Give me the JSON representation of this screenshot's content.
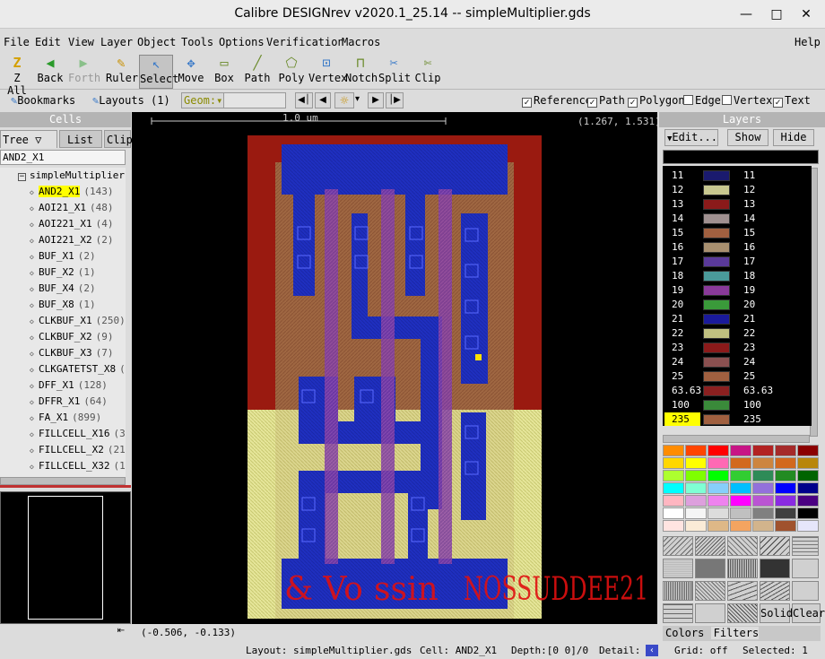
{
  "window": {
    "title": "Calibre DESIGNrev v2020.1_25.14  --  simpleMultiplier.gds",
    "minimize": "—",
    "maximize": "□",
    "close": "✕"
  },
  "menus": [
    "File",
    "Edit",
    "View",
    "Layer",
    "Object",
    "Tools",
    "Options",
    "Verification",
    "Macros"
  ],
  "help_menu": "Help",
  "tools": [
    {
      "label": "Z All",
      "icon": "Z",
      "state": "normal"
    },
    {
      "label": "Back",
      "icon": "◀",
      "state": "normal"
    },
    {
      "label": "Forth",
      "icon": "▶",
      "state": "disabled"
    },
    {
      "label": "Ruler",
      "icon": "✎",
      "state": "normal"
    },
    {
      "label": "Select",
      "icon": "↖",
      "state": "selected"
    },
    {
      "label": "Move",
      "icon": "✥",
      "state": "normal"
    },
    {
      "label": "Box",
      "icon": "▭",
      "state": "normal"
    },
    {
      "label": "Path",
      "icon": "╱",
      "state": "normal"
    },
    {
      "label": "Poly",
      "icon": "⬠",
      "state": "normal"
    },
    {
      "label": "Vertex",
      "icon": "⊡",
      "state": "normal"
    },
    {
      "label": "Notch",
      "icon": "⊓",
      "state": "normal"
    },
    {
      "label": "Split",
      "icon": "✂",
      "state": "normal"
    },
    {
      "label": "Clip",
      "icon": "✄",
      "state": "normal"
    }
  ],
  "toolbar2": {
    "bookmarks": "Bookmarks",
    "layouts": "Layouts (1)",
    "geom_label": "Geom:",
    "geom_value": "",
    "filters": [
      {
        "label": "Reference",
        "checked": true
      },
      {
        "label": "Path",
        "checked": true
      },
      {
        "label": "Polygon",
        "checked": true
      },
      {
        "label": "Edge",
        "checked": false
      },
      {
        "label": "Vertex",
        "checked": false
      },
      {
        "label": "Text",
        "checked": true
      }
    ]
  },
  "cells_panel": {
    "header": "Cells",
    "tabs": [
      "Tree ▽",
      "List",
      "Clip"
    ],
    "filter_value": "AND2_X1",
    "root": "simpleMultiplier",
    "items": [
      {
        "name": "AND2_X1",
        "count": "(143)",
        "highlight": true
      },
      {
        "name": "AOI21_X1",
        "count": "(48)"
      },
      {
        "name": "AOI221_X1",
        "count": "(4)"
      },
      {
        "name": "AOI221_X2",
        "count": "(2)"
      },
      {
        "name": "BUF_X1",
        "count": "(2)"
      },
      {
        "name": "BUF_X2",
        "count": "(1)"
      },
      {
        "name": "BUF_X4",
        "count": "(2)"
      },
      {
        "name": "BUF_X8",
        "count": "(1)"
      },
      {
        "name": "CLKBUF_X1",
        "count": "(250)"
      },
      {
        "name": "CLKBUF_X2",
        "count": "(9)"
      },
      {
        "name": "CLKBUF_X3",
        "count": "(7)"
      },
      {
        "name": "CLKGATETST_X8",
        "count": "("
      },
      {
        "name": "DFF_X1",
        "count": "(128)"
      },
      {
        "name": "DFFR_X1",
        "count": "(64)"
      },
      {
        "name": "FA_X1",
        "count": "(899)"
      },
      {
        "name": "FILLCELL_X16",
        "count": "(3"
      },
      {
        "name": "FILLCELL_X2",
        "count": "(21"
      },
      {
        "name": "FILLCELL_X32",
        "count": "(1"
      }
    ]
  },
  "canvas": {
    "scale_label": "1.0 um",
    "cursor_coords": "(1.267, 1.531)",
    "origin_coords": "(-0.506, -0.133)",
    "cell_text_1": "& Vo",
    "cell_text_2": "ssin",
    "cell_text_3": "NOSSUDDEE21"
  },
  "layers_panel": {
    "header": "Layers",
    "edit": "Edit...",
    "show": "Show",
    "hide": "Hide",
    "filter_value": "",
    "rows": [
      {
        "n1": "11",
        "n2": "11",
        "color": "#1a1a6e"
      },
      {
        "n1": "12",
        "n2": "12",
        "color": "#c8c890"
      },
      {
        "n1": "13",
        "n2": "13",
        "color": "#8b1a1a"
      },
      {
        "n1": "14",
        "n2": "14",
        "color": "#a09090"
      },
      {
        "n1": "15",
        "n2": "15",
        "color": "#a06040"
      },
      {
        "n1": "16",
        "n2": "16",
        "color": "#a89070"
      },
      {
        "n1": "17",
        "n2": "17",
        "color": "#5a3a9a"
      },
      {
        "n1": "18",
        "n2": "18",
        "color": "#4a9a9a"
      },
      {
        "n1": "19",
        "n2": "19",
        "color": "#8a3a9a"
      },
      {
        "n1": "20",
        "n2": "20",
        "color": "#3a9a3a"
      },
      {
        "n1": "21",
        "n2": "21",
        "color": "#1a1a9a"
      },
      {
        "n1": "22",
        "n2": "22",
        "color": "#c0c080"
      },
      {
        "n1": "23",
        "n2": "23",
        "color": "#8b1a1a"
      },
      {
        "n1": "24",
        "n2": "24",
        "color": "#8a5050"
      },
      {
        "n1": "25",
        "n2": "25",
        "color": "#a06040"
      },
      {
        "n1": "63.63",
        "n2": "63.63",
        "color": "#8b2020"
      },
      {
        "n1": "100",
        "n2": "100",
        "color": "#3a8a3a"
      },
      {
        "n1": "235",
        "n2": "235",
        "color": "#a06040",
        "highlight": true
      }
    ],
    "palette": [
      "#ff8c00",
      "#ff4500",
      "#ff0000",
      "#c71585",
      "#b22222",
      "#a52a2a",
      "#8b0000",
      "#ffd700",
      "#ffff00",
      "#ff69b4",
      "#d2691e",
      "#cd853f",
      "#d2691e",
      "#b8860b",
      "#adff2f",
      "#7fff00",
      "#00ff00",
      "#32cd32",
      "#2e8b57",
      "#228b22",
      "#006400",
      "#00ffff",
      "#7fffd4",
      "#87cefa",
      "#00bfff",
      "#9370db",
      "#0000ff",
      "#00008b",
      "#ffb6c1",
      "#dda0dd",
      "#ee82ee",
      "#ff00ff",
      "#ba55d3",
      "#8a2be2",
      "#4b0082",
      "#ffffff",
      "#f5f5f5",
      "#dcdcdc",
      "#c0c0c0",
      "#808080",
      "#404040",
      "#000000",
      "#ffe4e1",
      "#faebd7",
      "#deb887",
      "#f4a460",
      "#d2b48c",
      "#a0522d",
      "#e6e6fa"
    ],
    "solid": "Solid",
    "clear": "Clear",
    "bottom_tabs": [
      "Colors",
      "Filters"
    ]
  },
  "statusbar": {
    "layout": "Layout: simpleMultiplier.gds",
    "cell": "Cell: AND2_X1",
    "depth": "Depth:[0 0]/0",
    "detail": "Detail:",
    "grid": "Grid: off",
    "selected": "Selected: 1"
  }
}
